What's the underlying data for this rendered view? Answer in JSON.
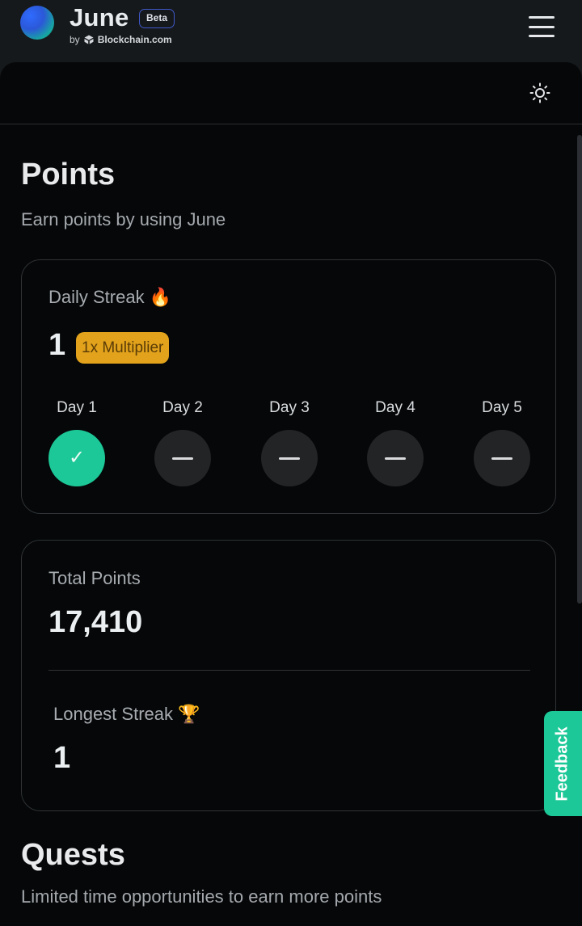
{
  "brand": {
    "name": "June",
    "badge": "Beta",
    "by": "by",
    "company": "Blockchain.com"
  },
  "header": {
    "menu_icon": "hamburger-menu-icon",
    "theme_icon": "sun-icon"
  },
  "points": {
    "title": "Points",
    "subtitle": "Earn points by using June"
  },
  "daily_streak": {
    "label": "Daily Streak 🔥",
    "value": "1",
    "multiplier": "1x Multiplier",
    "days": [
      {
        "label": "Day 1",
        "status": "done"
      },
      {
        "label": "Day 2",
        "status": "pending"
      },
      {
        "label": "Day 3",
        "status": "pending"
      },
      {
        "label": "Day 4",
        "status": "pending"
      },
      {
        "label": "Day 5",
        "status": "pending"
      }
    ]
  },
  "totals": {
    "total_label": "Total Points",
    "total_value": "17,410",
    "longest_label": "Longest Streak 🏆",
    "longest_value": "1"
  },
  "quests": {
    "title": "Quests",
    "subtitle": "Limited time opportunities to earn more points"
  },
  "feedback": {
    "label": "Feedback"
  },
  "colors": {
    "accent_green": "#1cc897",
    "multiplier_orange": "#e2a21b",
    "badge_border": "#3f58c9"
  }
}
